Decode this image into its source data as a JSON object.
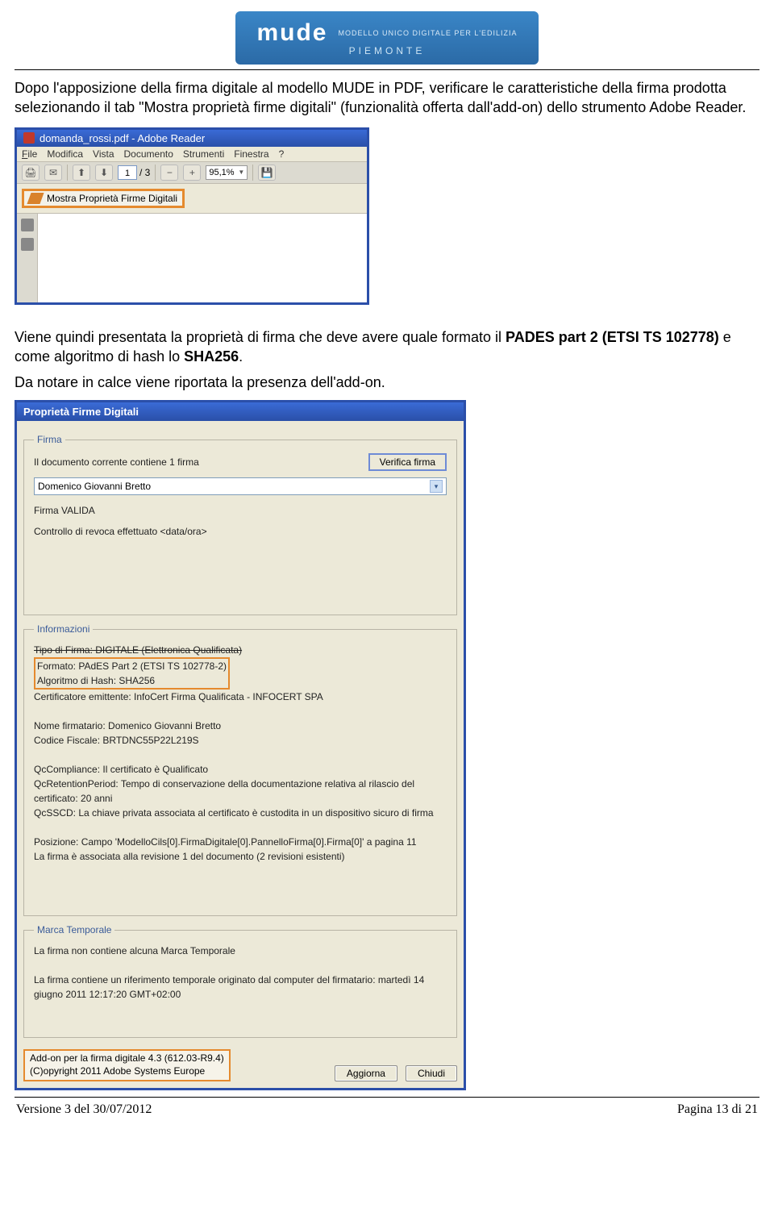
{
  "logo": {
    "title": "mude",
    "subtitle": "MODELLO UNICO DIGITALE PER L'EDILIZIA",
    "region": "PIEMONTE"
  },
  "body": {
    "p1": "Dopo l'apposizione della firma digitale al modello MUDE in PDF, verificare le caratteristiche della firma prodotta selezionando il tab \"Mostra proprietà firme digitali\" (funzionalità offerta dall'add-on) dello strumento Adobe Reader.",
    "p2_pre": "Viene quindi presentata la proprietà di firma che deve avere quale formato il ",
    "p2_b1": "PADES part 2 (ETSI TS 102778)",
    "p2_mid": " e come algoritmo di hash lo ",
    "p2_b2": "SHA256",
    "p2_end": ".",
    "p3": "Da notare in calce viene riportata la presenza dell'add-on."
  },
  "reader": {
    "title": "domanda_rossi.pdf - Adobe Reader",
    "menu": {
      "file": "File",
      "modifica": "Modifica",
      "vista": "Vista",
      "documento": "Documento",
      "strumenti": "Strumenti",
      "finestra": "Finestra",
      "help": "?"
    },
    "page_current": "1",
    "page_total": "/ 3",
    "zoom": "95,1%",
    "prop_tab": "Mostra Proprietà Firme Digitali"
  },
  "dialog": {
    "title": "Proprietà Firme Digitali",
    "firma": {
      "legend": "Firma",
      "contains": "Il documento corrente contiene 1 firma",
      "verify_btn": "Verifica firma",
      "signer": "Domenico Giovanni Bretto",
      "valid": "Firma VALIDA",
      "revoke": "Controllo di revoca effettuato <data/ora>"
    },
    "info": {
      "legend": "Informazioni",
      "tipo": "Tipo di Firma: DIGITALE (Elettronica Qualificata)",
      "formato": "Formato: PAdES Part 2 (ETSI TS 102778-2)",
      "hash": "Algoritmo di Hash: SHA256",
      "cert": "Certificatore emittente: InfoCert Firma Qualificata - INFOCERT SPA",
      "nome": "Nome firmatario: Domenico Giovanni Bretto",
      "cf": "Codice Fiscale: BRTDNC55P22L219S",
      "qc": "QcCompliance: Il certificato è Qualificato",
      "qret": "QcRetentionPeriod: Tempo di conservazione della documentazione relativa al rilascio del certificato: 20 anni",
      "qssd": "QcSSCD: La chiave privata associata al certificato è custodita in un dispositivo sicuro di firma",
      "pos": "Posizione: Campo 'ModelloCils[0].FirmaDigitale[0].PannelloFirma[0].Firma[0]' a pagina 11",
      "rev": "La firma è associata alla revisione 1 del documento (2 revisioni esistenti)"
    },
    "marca": {
      "legend": "Marca Temporale",
      "l1": "La firma non contiene alcuna Marca Temporale",
      "l2": "La firma contiene un riferimento temporale originato dal computer del firmatario: martedì 14 giugno 2011 12:17:20 GMT+02:00"
    },
    "addon": {
      "l1": "Add-on per la firma digitale 4.3 (612.03-R9.4)",
      "l2": "(C)opyright 2011 Adobe Systems Europe"
    },
    "buttons": {
      "aggiorna": "Aggiorna",
      "chiudi": "Chiudi"
    }
  },
  "footer": {
    "left": "Versione 3 del 30/07/2012",
    "right": "Pagina 13 di 21"
  }
}
